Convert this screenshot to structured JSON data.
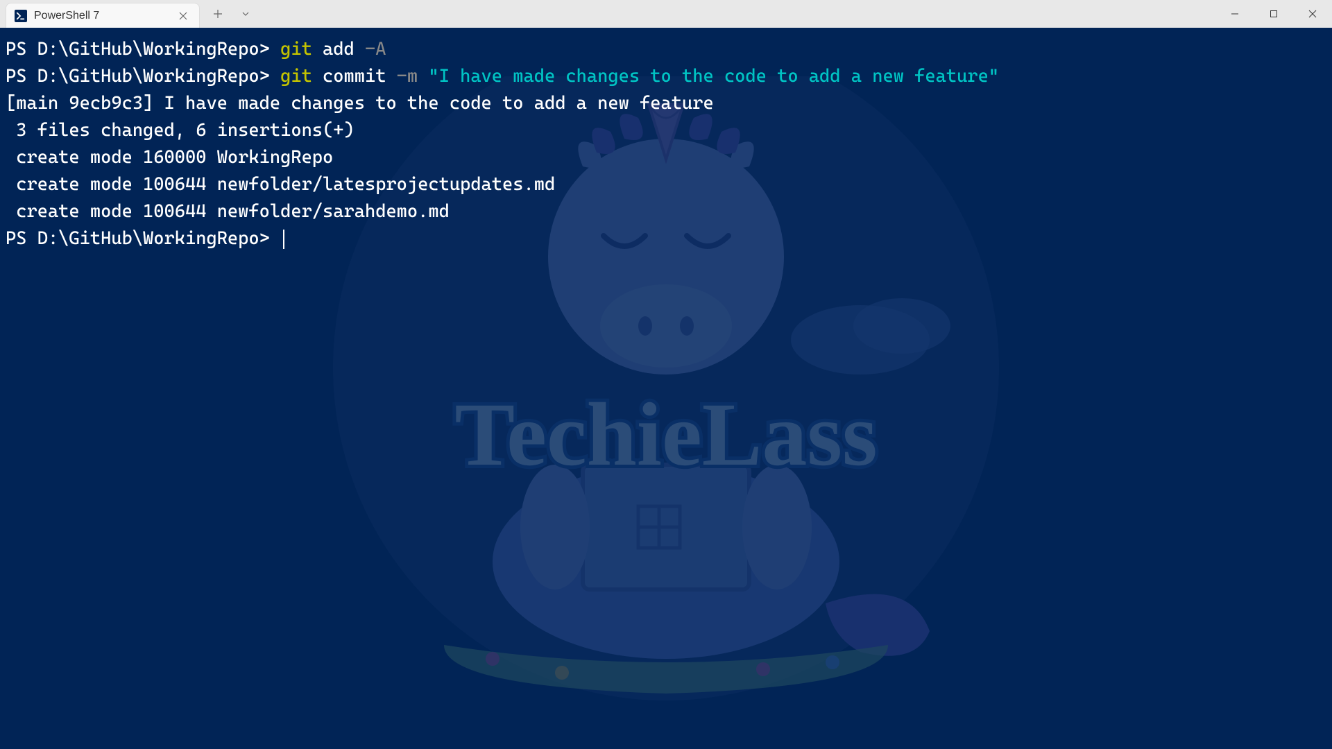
{
  "window": {
    "tab_title": "PowerShell 7"
  },
  "terminal": {
    "lines": [
      {
        "type": "cmd",
        "prompt": "PS D:\\GitHub\\WorkingRepo> ",
        "git": "git",
        "sub": " add ",
        "flag": "-A",
        "str": ""
      },
      {
        "type": "cmd",
        "prompt": "PS D:\\GitHub\\WorkingRepo> ",
        "git": "git",
        "sub": " commit ",
        "flag": "-m ",
        "str": "\"I have made changes to the code to add a new feature\""
      },
      {
        "type": "out",
        "text": "[main 9ecb9c3] I have made changes to the code to add a new feature"
      },
      {
        "type": "out",
        "text": " 3 files changed, 6 insertions(+)"
      },
      {
        "type": "out",
        "text": " create mode 160000 WorkingRepo"
      },
      {
        "type": "out",
        "text": " create mode 100644 newfolder/latesprojectupdates.md"
      },
      {
        "type": "out",
        "text": " create mode 100644 newfolder/sarahdemo.md"
      },
      {
        "type": "prompt_only",
        "prompt": "PS D:\\GitHub\\WorkingRepo> "
      }
    ]
  }
}
